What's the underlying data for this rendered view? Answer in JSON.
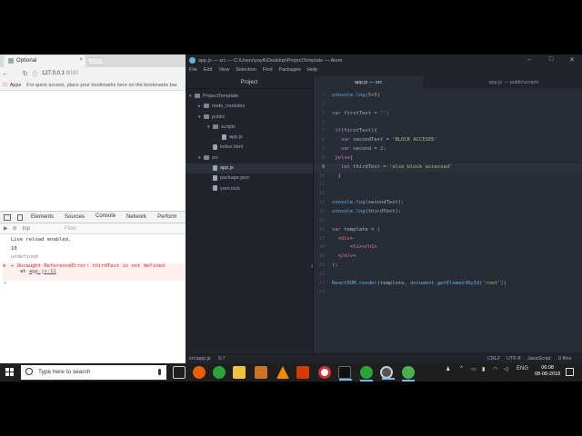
{
  "chrome": {
    "tab_title": "Optional",
    "tab_close": "×",
    "url_host": "127.0.0.1",
    "url_port": ":8080",
    "bookmarks_apps": "Apps",
    "bookmarks_hint": "For quick access, place your bookmarks here on the bookmarks bar.",
    "devtools_tabs": [
      "Elements",
      "Sources",
      "Console",
      "Network",
      "Perform"
    ],
    "console_context": "top",
    "console_filter_placeholder": "Filter",
    "console_lines": {
      "reload": "Live reload enabled.",
      "ten": "10",
      "undef": "undefined",
      "error": "Uncaught ReferenceError: thirdTest is not defined",
      "error_at": "at ",
      "error_link": "app.js:11"
    },
    "prompt": ">"
  },
  "atom": {
    "title": "app.js — src — C:\\Users\\yaylk\\Desktop\\ProjectTemplate — Atom",
    "menu": [
      "File",
      "Edit",
      "View",
      "Selection",
      "Find",
      "Packages",
      "Help"
    ],
    "tree_header": "Project",
    "tree": [
      {
        "label": "ProjectTemplate",
        "arrow": "▾",
        "folder": true
      },
      {
        "label": "node_modules",
        "arrow": "▸",
        "folder": true
      },
      {
        "label": "public",
        "arrow": "▾",
        "folder": true
      },
      {
        "label": "scripts",
        "arrow": "▾",
        "folder": true
      },
      {
        "label": "app.js",
        "arrow": "",
        "folder": false
      },
      {
        "label": "index.html",
        "arrow": "",
        "folder": false
      },
      {
        "label": "src",
        "arrow": "▾",
        "folder": true
      },
      {
        "label": "app.js",
        "arrow": "",
        "folder": false,
        "selected": true
      },
      {
        "label": "package.json",
        "arrow": "",
        "folder": false
      },
      {
        "label": "yarn.lock",
        "arrow": "",
        "folder": false
      }
    ],
    "tabs": [
      "app.js — src",
      "app.js — public\\scripts"
    ],
    "code_lines": [
      "1",
      "2",
      "3",
      "4",
      "5",
      "6",
      "7",
      "8",
      "9",
      "10",
      "11",
      "12",
      "13",
      "14",
      "15",
      "16",
      "17",
      "18",
      "19",
      "20",
      "21",
      "22",
      "23"
    ],
    "status": {
      "path": "src\\app.js",
      "cursor": "9:7",
      "eol": "CRLF",
      "encoding": "UTF-8",
      "grammar": "JavaScript",
      "files": "0 files"
    }
  },
  "taskbar": {
    "search_placeholder": "Type here to search",
    "lang": "ENG",
    "time": "06:08",
    "date": "08-08-2018"
  }
}
